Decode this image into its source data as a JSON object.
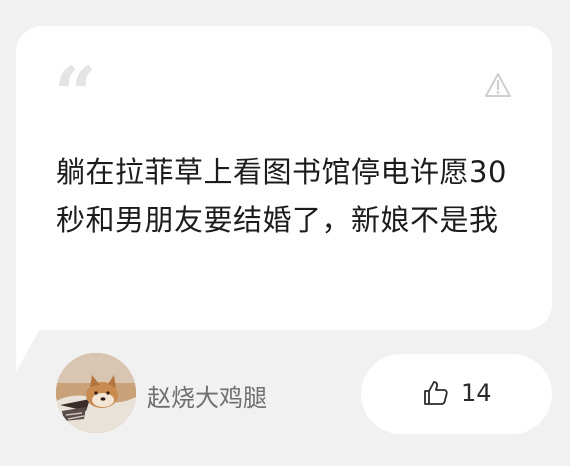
{
  "post": {
    "text": "躺在拉菲草上看图书馆停电许愿30秒和男朋友要结婚了，新娘不是我"
  },
  "author": {
    "name": "赵烧大鸡腿",
    "avatar": "shiba-dog-avatar"
  },
  "like": {
    "count": "14"
  },
  "icons": {
    "quote": "quote-icon",
    "warning": "warning-triangle-icon",
    "like": "thumbs-up-icon"
  },
  "colors": {
    "background": "#f1f1f1",
    "card": "#ffffff",
    "text": "#1c1c1c",
    "muted": "#6f6f6f",
    "quote": "#e4e4e4"
  }
}
